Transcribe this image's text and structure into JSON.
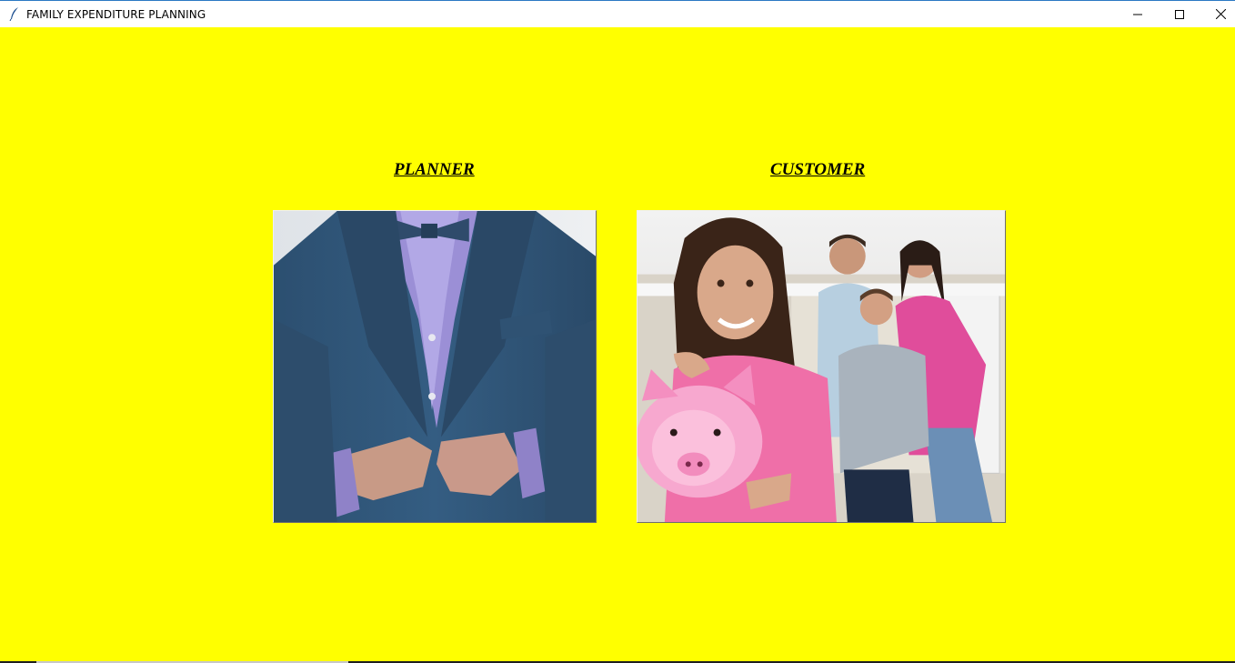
{
  "window": {
    "title": "FAMILY EXPENDITURE PLANNING",
    "controls": {
      "minimize": "minimize",
      "maximize": "maximize",
      "close": "close"
    }
  },
  "main": {
    "background_color": "#ffff00",
    "options": [
      {
        "id": "planner",
        "label": "PLANNER",
        "image": "man-in-suit-photo"
      },
      {
        "id": "customer",
        "label": "CUSTOMER",
        "image": "family-with-piggy-bank-photo"
      }
    ]
  }
}
